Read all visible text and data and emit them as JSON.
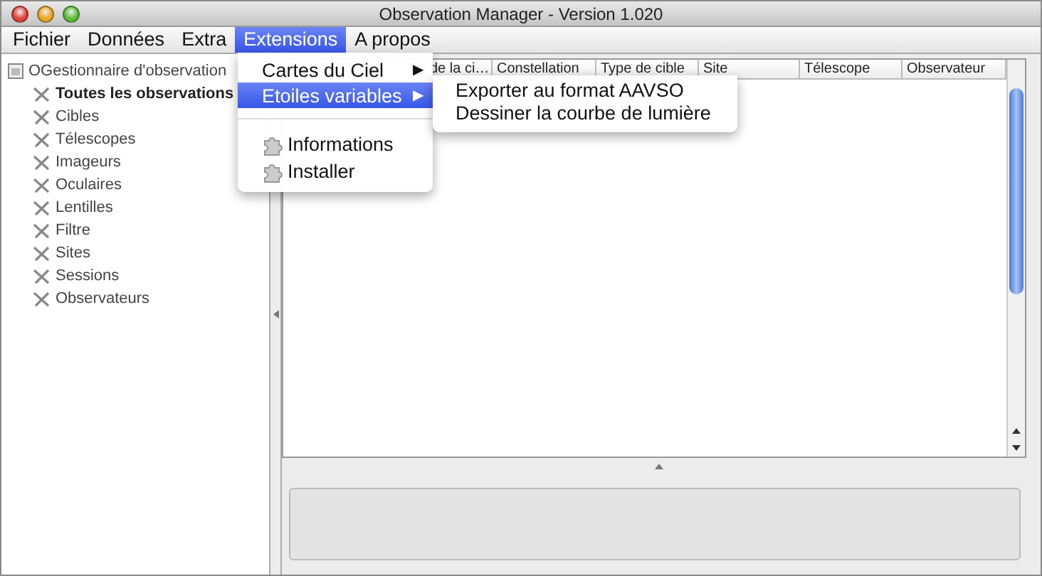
{
  "window": {
    "title": "Observation Manager - Version 1.020"
  },
  "menubar": [
    {
      "label": "Fichier",
      "selected": false
    },
    {
      "label": "Données",
      "selected": false
    },
    {
      "label": "Extra",
      "selected": false
    },
    {
      "label": "Extensions",
      "selected": true
    },
    {
      "label": "A propos",
      "selected": false
    }
  ],
  "menu": {
    "items": [
      {
        "kind": "submenu",
        "label": "Cartes du Ciel",
        "arrow": "▶",
        "selected": false
      },
      {
        "kind": "submenu",
        "label": "Etoiles variables",
        "arrow": "▶",
        "selected": true
      },
      {
        "kind": "separator"
      },
      {
        "kind": "plugin",
        "label": "Informations",
        "selected": false
      },
      {
        "kind": "plugin",
        "label": "Installer",
        "selected": false
      }
    ]
  },
  "submenu": {
    "items": [
      {
        "label": "Exporter au format AAVSO"
      },
      {
        "label": "Dessiner la courbe de lumière"
      }
    ]
  },
  "tree": {
    "label": "OGestionnaire d'observation",
    "children": [
      {
        "label": "Toutes les observations",
        "selected": true
      },
      {
        "label": "Cibles",
        "selected": false
      },
      {
        "label": "Télescopes",
        "selected": false
      },
      {
        "label": "Imageurs",
        "selected": false
      },
      {
        "label": "Oculaires",
        "selected": false
      },
      {
        "label": "Lentilles",
        "selected": false
      },
      {
        "label": "Filtre",
        "selected": false
      },
      {
        "label": "Sites",
        "selected": false
      },
      {
        "label": "Sessions",
        "selected": false
      },
      {
        "label": "Observateurs",
        "selected": false
      }
    ]
  },
  "table": {
    "columns": [
      "de la ci…",
      "Constellation",
      "Type de cible",
      "Site",
      "Télescope",
      "Observateur"
    ]
  }
}
